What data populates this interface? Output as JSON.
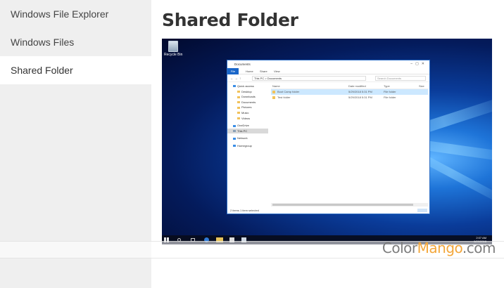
{
  "sidebar": {
    "items": [
      {
        "label": "Windows File Explorer",
        "active": false
      },
      {
        "label": "Windows Files",
        "active": false
      },
      {
        "label": "Shared Folder",
        "active": true
      }
    ]
  },
  "main": {
    "title": "Shared Folder"
  },
  "screenshot": {
    "desktop": {
      "recycle_bin_label": "Recycle Bin"
    },
    "explorer": {
      "title": "Documents",
      "ribbon_tabs": [
        "File",
        "Home",
        "Share",
        "View"
      ],
      "address": "This PC  >  Documents",
      "search_placeholder": "Search Documents",
      "nav": [
        {
          "label": "Quick access",
          "sub": false,
          "icon": "star-icon"
        },
        {
          "label": "Desktop",
          "sub": true,
          "icon": "folder-icon"
        },
        {
          "label": "Downloads",
          "sub": true,
          "icon": "folder-icon"
        },
        {
          "label": "Documents",
          "sub": true,
          "icon": "folder-icon"
        },
        {
          "label": "Pictures",
          "sub": true,
          "icon": "folder-icon"
        },
        {
          "label": "Music",
          "sub": true,
          "icon": "folder-icon"
        },
        {
          "label": "Videos",
          "sub": true,
          "icon": "folder-icon"
        },
        {
          "label": "OneDrive",
          "sub": false,
          "icon": "cloud-icon"
        },
        {
          "label": "This PC",
          "sub": false,
          "icon": "pc-icon",
          "selected": true
        },
        {
          "label": "Network",
          "sub": false,
          "icon": "network-icon"
        },
        {
          "label": "Homegroup",
          "sub": false,
          "icon": "homegroup-icon"
        }
      ],
      "columns": [
        "Name",
        "Date modified",
        "Type",
        "Size"
      ],
      "files": [
        {
          "name": "Boot Camp folder",
          "date": "5/29/2018 5:31 PM",
          "type": "File folder",
          "selected": true
        },
        {
          "name": "Test folder",
          "date": "5/29/2018 5:31 PM",
          "type": "File folder",
          "selected": false
        }
      ],
      "status": "2 items   1 item selected"
    },
    "taskbar": {
      "time": "2:07 AM",
      "date": "5/29/2018"
    }
  },
  "watermark": {
    "part1": "Color",
    "part2": "Mango",
    "part3": ".com"
  },
  "colors": {
    "accent": "#1a66c9",
    "watermark_orange": "#f3a73b",
    "sidebar_bg": "#efefef"
  }
}
